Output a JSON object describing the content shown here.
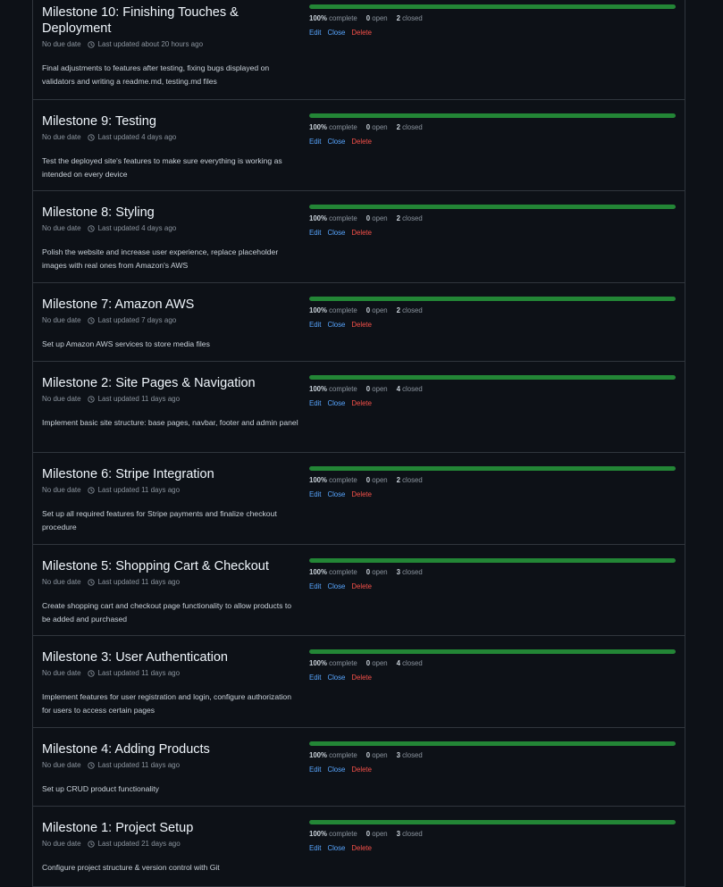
{
  "labels": {
    "complete": "complete",
    "open": "open",
    "closed": "closed",
    "edit": "Edit",
    "close": "Close",
    "delete": "Delete"
  },
  "colors": {
    "progress": "#238636",
    "link": "#58a6ff",
    "danger": "#f85149"
  },
  "milestones": [
    {
      "title": "Milestone 10: Finishing Touches & Deployment",
      "due": "No due date",
      "updated": "Last updated about 20 hours ago",
      "description": "Final adjustments to features after testing, fixing bugs displayed on validators and writing a readme.md, testing.md files",
      "percent": "100%",
      "open": "0",
      "closed": "2",
      "progress": 1.0
    },
    {
      "title": "Milestone 9: Testing",
      "due": "No due date",
      "updated": "Last updated 4 days ago",
      "description": "Test the deployed site's features to make sure everything is working as intended on every device",
      "percent": "100%",
      "open": "0",
      "closed": "2",
      "progress": 1.0
    },
    {
      "title": "Milestone 8: Styling",
      "due": "No due date",
      "updated": "Last updated 4 days ago",
      "description": "Polish the website and increase user experience, replace placeholder images with real ones from Amazon's AWS",
      "percent": "100%",
      "open": "0",
      "closed": "2",
      "progress": 1.0
    },
    {
      "title": "Milestone 7: Amazon AWS",
      "due": "No due date",
      "updated": "Last updated 7 days ago",
      "description": "Set up Amazon AWS services to store media files",
      "percent": "100%",
      "open": "0",
      "closed": "2",
      "progress": 1.0
    },
    {
      "title": "Milestone 2: Site Pages & Navigation",
      "due": "No due date",
      "updated": "Last updated 11 days ago",
      "description": "Implement basic site structure: base pages, navbar, footer and admin panel",
      "percent": "100%",
      "open": "0",
      "closed": "4",
      "progress": 1.0
    },
    {
      "title": "Milestone 6: Stripe Integration",
      "due": "No due date",
      "updated": "Last updated 11 days ago",
      "description": "Set up all required features for Stripe payments and finalize checkout procedure",
      "percent": "100%",
      "open": "0",
      "closed": "2",
      "progress": 1.0
    },
    {
      "title": "Milestone 5: Shopping Cart & Checkout",
      "due": "No due date",
      "updated": "Last updated 11 days ago",
      "description": "Create shopping cart and checkout page functionality to allow products to be added and purchased",
      "percent": "100%",
      "open": "0",
      "closed": "3",
      "progress": 1.0
    },
    {
      "title": "Milestone 3: User Authentication",
      "due": "No due date",
      "updated": "Last updated 11 days ago",
      "description": "Implement features for user registration and login, configure authorization for users to access certain pages",
      "percent": "100%",
      "open": "0",
      "closed": "4",
      "progress": 1.0
    },
    {
      "title": "Milestone 4: Adding Products",
      "due": "No due date",
      "updated": "Last updated 11 days ago",
      "description": "Set up CRUD product functionality",
      "percent": "100%",
      "open": "0",
      "closed": "3",
      "progress": 1.0
    },
    {
      "title": "Milestone 1: Project Setup",
      "due": "No due date",
      "updated": "Last updated 21 days ago",
      "description": "Configure project structure & version control with Git",
      "percent": "100%",
      "open": "0",
      "closed": "3",
      "progress": 1.0
    }
  ]
}
